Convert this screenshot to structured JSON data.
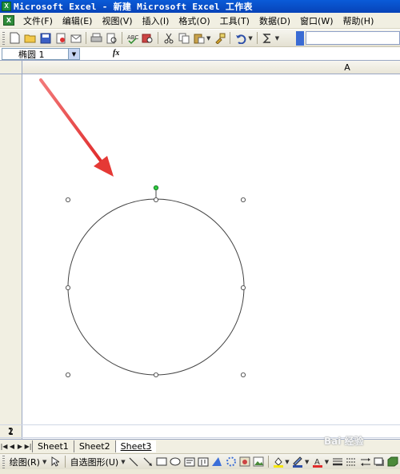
{
  "titlebar": {
    "title": "Microsoft Excel - 新建 Microsoft Excel 工作表"
  },
  "menubar": {
    "items": [
      {
        "label": "文件(F)"
      },
      {
        "label": "编辑(E)"
      },
      {
        "label": "视图(V)"
      },
      {
        "label": "插入(I)"
      },
      {
        "label": "格式(O)"
      },
      {
        "label": "工具(T)"
      },
      {
        "label": "数据(D)"
      },
      {
        "label": "窗口(W)"
      },
      {
        "label": "帮助(H)"
      }
    ]
  },
  "formula_bar": {
    "name_box_value": "椭圆 1",
    "fx_label": "fx"
  },
  "grid": {
    "column_header": "A",
    "row_labels": [
      "1",
      "2"
    ]
  },
  "sheet_tabs": {
    "tabs": [
      "Sheet1",
      "Sheet2",
      "Sheet3"
    ],
    "active": "Sheet3"
  },
  "draw_toolbar": {
    "draw_label": "绘图(R)",
    "autoshapes_label": "自选图形(U)"
  },
  "colors": {
    "title_bar": "#0a5bd8",
    "annotation_arrow": "#e53935",
    "rotate_handle": "#2ecc40"
  },
  "watermark": {
    "text": "Bai 经验"
  }
}
